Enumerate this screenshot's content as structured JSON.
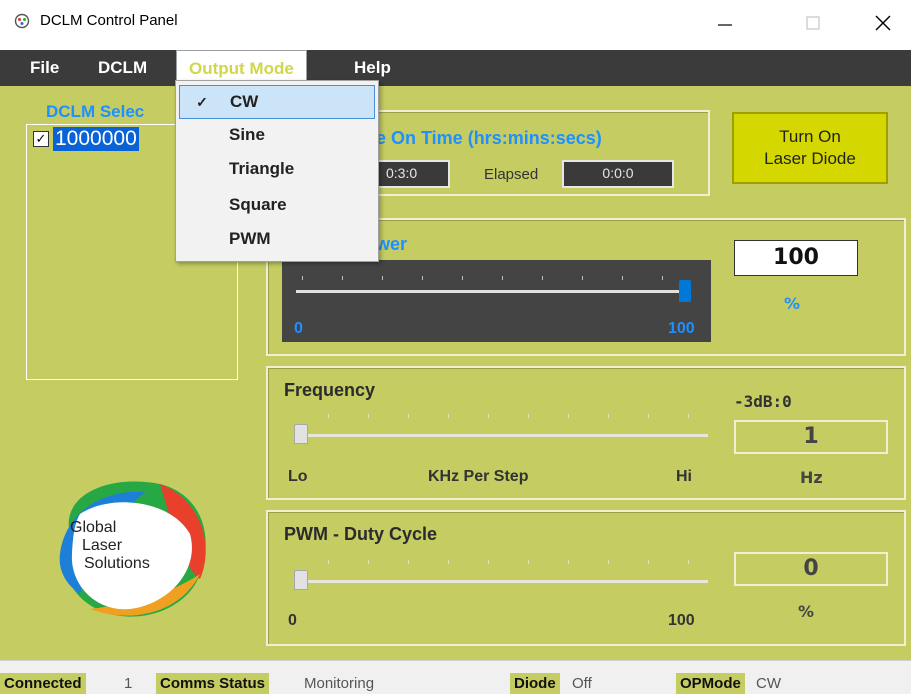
{
  "window": {
    "title": "DCLM Control Panel",
    "minimize_icon": "minimize-icon",
    "maximize_icon": "maximize-icon",
    "close_icon": "close-icon"
  },
  "menu": {
    "file": "File",
    "dclm": "DCLM",
    "output_mode": "Output Mode",
    "help": "Help"
  },
  "output_mode_menu": {
    "items": [
      {
        "label": "CW",
        "checked": true
      },
      {
        "label": "Sine",
        "checked": false
      },
      {
        "label": "Triangle",
        "checked": false
      },
      {
        "label": "Square",
        "checked": false
      },
      {
        "label": "PWM",
        "checked": false
      }
    ],
    "check_glyph": "✓"
  },
  "dclm_select": {
    "label": "DCLM Selec",
    "devices": [
      {
        "serial": "1000000",
        "checked": true
      }
    ]
  },
  "on_time": {
    "title": "e On Time (hrs:mins:secs)",
    "set_value": "0:3:0",
    "elapsed_label": "Elapsed",
    "elapsed_value": "0:0:0"
  },
  "turn_on_button": {
    "line1": "Turn On",
    "line2": "Laser Diode"
  },
  "power": {
    "title": "wer",
    "min_label": "0",
    "max_label": "100",
    "value": "100",
    "unit": "%",
    "level": 1.0
  },
  "frequency": {
    "title": "Frequency",
    "db_label": "-3dB:0",
    "value": "1",
    "unit": "Hz",
    "lo_label": "Lo",
    "step_label": "KHz Per Step",
    "hi_label": "Hi",
    "level": 0.0
  },
  "pwm": {
    "title": "PWM - Duty Cycle",
    "value": "0",
    "unit": "%",
    "min_label": "0",
    "max_label": "100",
    "level": 0.0
  },
  "logo": {
    "line1": "Global",
    "line2": "Laser",
    "line3": "Solutions"
  },
  "status_bar": {
    "connected_label": "Connected",
    "connected_value": "1",
    "comms_label": "Comms Status",
    "comms_value": "Monitoring",
    "diode_label": "Diode",
    "diode_value": "Off",
    "opmode_label": "OPMode",
    "opmode_value": "CW"
  },
  "colors": {
    "background": "#c4cc62",
    "accent_blue": "#1e90ff",
    "button_yellow": "#d4d800",
    "menu_bar": "#3b3b3b"
  }
}
